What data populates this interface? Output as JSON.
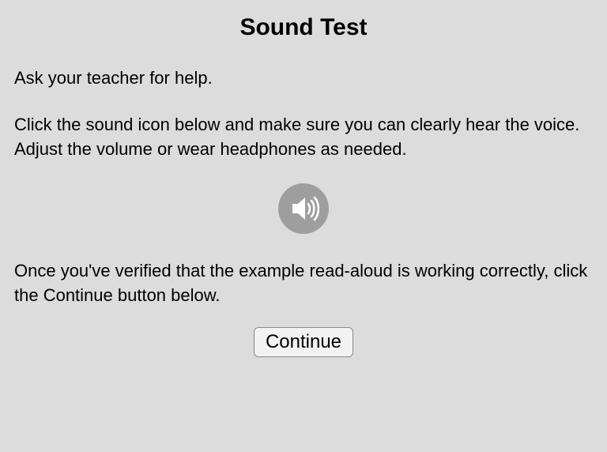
{
  "title": "Sound Test",
  "instructions": {
    "line1": "Ask your teacher for help.",
    "line2": "Click the sound icon below and make sure you can clearly hear the voice. Adjust the volume or wear headphones as needed.",
    "line3": "Once you've verified that the example read-aloud is working correctly, click the Continue button below."
  },
  "buttons": {
    "continue_label": "Continue"
  },
  "icons": {
    "sound": "speaker-icon"
  },
  "colors": {
    "background": "#dcdcdc",
    "icon_bg": "#9e9e9e",
    "icon_fg": "#ffffff"
  }
}
